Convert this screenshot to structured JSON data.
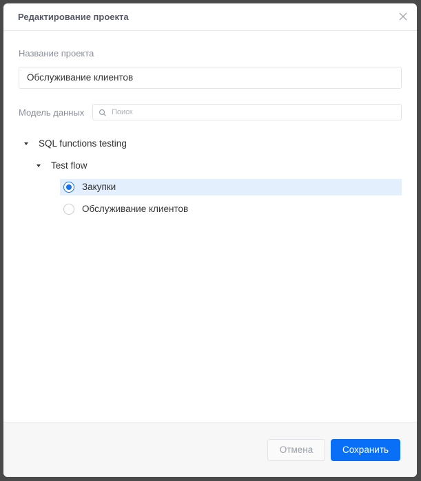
{
  "dialog": {
    "title": "Редактирование проекта",
    "close_icon": "close-icon"
  },
  "form": {
    "project_name_label": "Название проекта",
    "project_name_value": "Обслуживание клиентов",
    "data_model_label": "Модель данных",
    "search_placeholder": "Поиск"
  },
  "tree": {
    "root": {
      "label": "SQL functions testing",
      "expanded": true
    },
    "child": {
      "label": "Test flow",
      "expanded": true
    },
    "options": [
      {
        "label": "Закупки",
        "selected": true
      },
      {
        "label": "Обслуживание клиентов",
        "selected": false
      }
    ]
  },
  "footer": {
    "cancel_label": "Отмена",
    "save_label": "Сохранить"
  },
  "colors": {
    "accent": "#0a6ff7",
    "selected_row": "#e3effc"
  }
}
